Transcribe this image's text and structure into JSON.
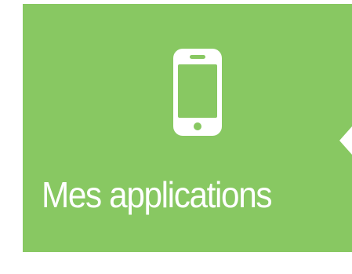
{
  "tile": {
    "label": "Mes applications",
    "icon": "smartphone-icon",
    "background_color": "#88c862",
    "foreground_color": "#ffffff"
  }
}
